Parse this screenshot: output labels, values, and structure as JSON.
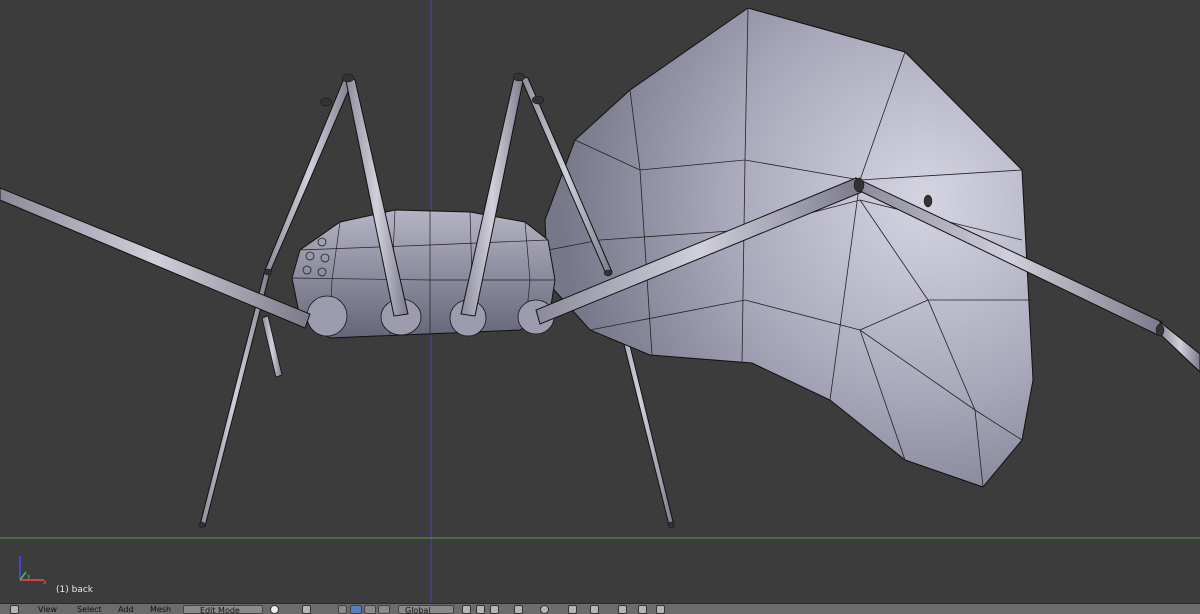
{
  "viewport": {
    "object_label": "(1) back",
    "axis": {
      "x": "x",
      "y": "y"
    }
  },
  "header": {
    "menu_view": "View",
    "menu_select": "Select",
    "menu_add": "Add",
    "menu_mesh": "Mesh",
    "mode_label": "Edit Mode",
    "orientation_label": "Global"
  },
  "colors": {
    "viewport_bg": "#3c3c3c",
    "mesh_fill": "#a4a4b6",
    "wire": "#000000",
    "axis_x_line": "#5a9a4a",
    "axis_z_line": "#4646a6",
    "header_bg": "#6c6c6c",
    "active_button": "#5680c2"
  },
  "icons": [
    "editor-type-icon",
    "shading-solid-icon",
    "pivot-point-icon",
    "manipulator-icon",
    "translate-icon",
    "rotate-icon",
    "scale-icon",
    "layer-icon",
    "proportional-edit-icon",
    "snap-icon",
    "render-icon"
  ]
}
